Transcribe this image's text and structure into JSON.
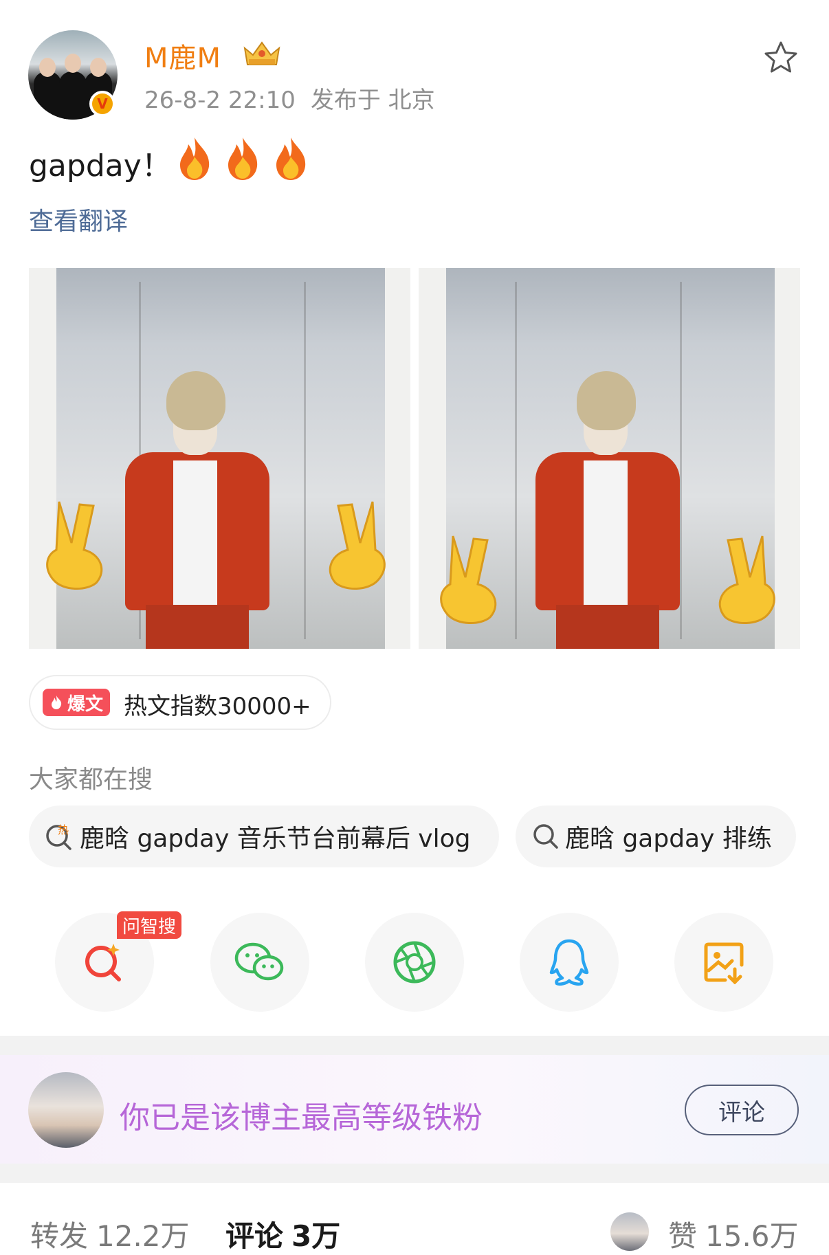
{
  "post": {
    "author": {
      "name": "M鹿M",
      "verified_badge": "V"
    },
    "time": "26-8-2 22:10",
    "location": "发布于 北京",
    "text": "gapday！",
    "emojis": [
      "fire",
      "fire",
      "fire"
    ],
    "translate_link": "查看翻译",
    "images": [
      {
        "icon": "photo-1"
      },
      {
        "icon": "photo-2"
      }
    ]
  },
  "hot": {
    "badge": "爆文",
    "index_text": "热文指数30000+"
  },
  "search": {
    "heading": "大家都在搜",
    "chips": [
      {
        "icon": "hot-search-icon",
        "text": "鹿晗 gapday 音乐节台前幕后 vlog"
      },
      {
        "icon": "search-icon",
        "text": "鹿晗 gapday 排练"
      }
    ]
  },
  "share": {
    "wenzhi_tag": "问智搜",
    "items": [
      "ai-search-icon",
      "wechat-icon",
      "moments-icon",
      "qq-icon",
      "save-image-icon"
    ],
    "colors": {
      "ai": "#f0443a",
      "wechat": "#3cb95a",
      "moments": "#3cb95a",
      "qq": "#28a4f0",
      "save": "#f2a117"
    }
  },
  "fan": {
    "text": "你已是该博主最高等级铁粉",
    "comment_button": "评论"
  },
  "stats": {
    "forward_label": "转发",
    "forward_count": "12.2万",
    "comment_label": "评论",
    "comment_count": "3万",
    "like_label": "赞",
    "like_count": "15.6万"
  },
  "colors": {
    "username": "#f07e12",
    "translate": "#4e6b96",
    "fan_text": "#b666d8",
    "hot_badge": "#f5505a"
  }
}
